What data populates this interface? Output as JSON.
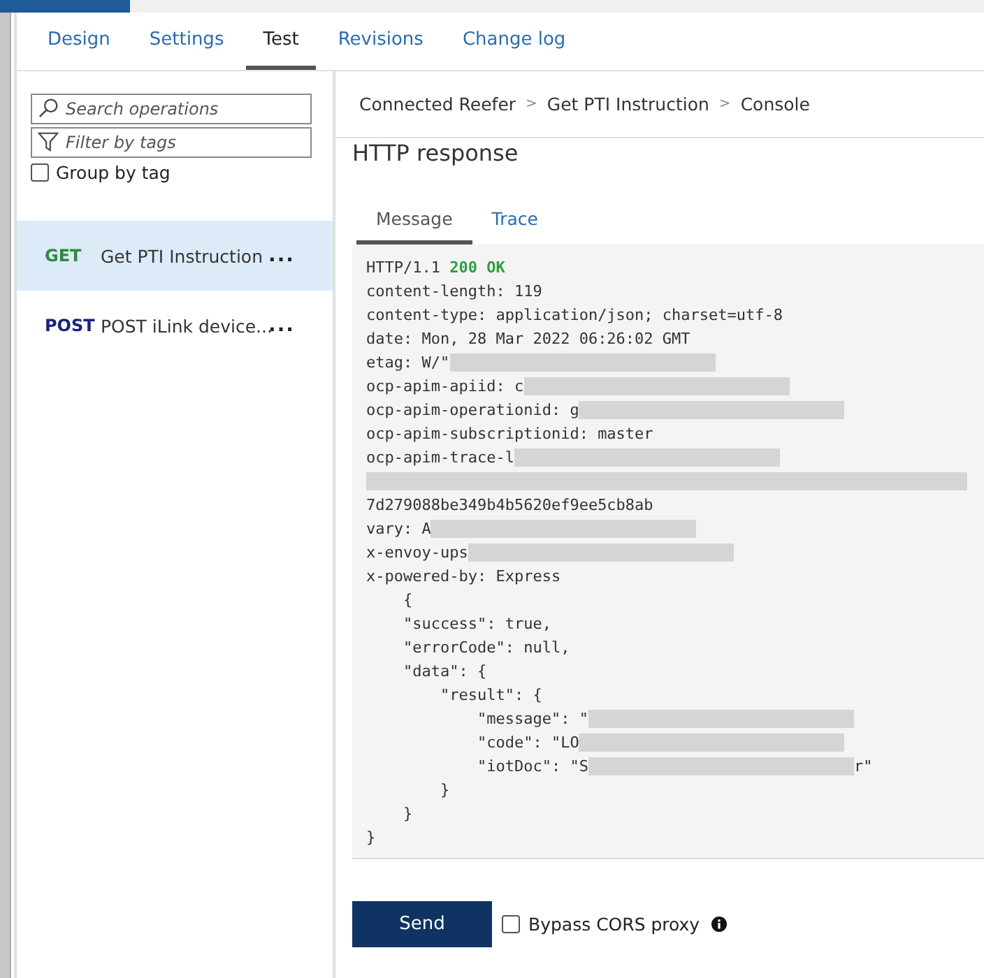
{
  "tabs": [
    {
      "label": "Design",
      "selected": false
    },
    {
      "label": "Settings",
      "selected": false
    },
    {
      "label": "Test",
      "selected": true
    },
    {
      "label": "Revisions",
      "selected": false
    },
    {
      "label": "Change log",
      "selected": false
    }
  ],
  "sidebar": {
    "search": {
      "placeholder": "Search operations"
    },
    "filter": {
      "placeholder": "Filter by tags"
    },
    "group_by_tag": {
      "label": "Group by tag",
      "checked": false
    },
    "operations": [
      {
        "method": "GET",
        "color": "#2e8b3e",
        "name": "Get PTI Instruction",
        "selected": true,
        "menu": "..."
      },
      {
        "method": "POST",
        "color": "#1a237e",
        "name": "POST iLink device...",
        "selected": false,
        "menu": "..."
      }
    ]
  },
  "breadcrumb": {
    "separator": ">",
    "items": [
      "Connected Reefer",
      "Get PTI Instruction",
      "Console"
    ]
  },
  "response": {
    "title": "HTTP response",
    "tabs": [
      {
        "label": "Message",
        "selected": true
      },
      {
        "label": "Trace",
        "selected": false
      }
    ],
    "lines": [
      {
        "text": "HTTP/1.1",
        "status": "200 OK"
      },
      {
        "text": "content-length: 119"
      },
      {
        "text": "content-type: application/json; charset=utf-8"
      },
      {
        "text": "date: Mon, 28 Mar 2022 06:26:02 GMT"
      },
      {
        "text": "etag: W/\"",
        "redacted": true
      },
      {
        "text": "ocp-apim-apiid: c",
        "redacted": true
      },
      {
        "text": "ocp-apim-operationid: g",
        "redacted": true
      },
      {
        "text": "ocp-apim-subscriptionid: master"
      },
      {
        "text": "ocp-apim-trace-l",
        "redacted": true
      },
      {
        "redacted": true
      },
      {
        "text": "7d279088be349b4b5620ef9ee5cb8ab"
      },
      {
        "text": "vary: A",
        "redacted": true
      },
      {
        "text": "x-envoy-ups",
        "redacted": true
      },
      {
        "text": "x-powered-by: Express"
      },
      {
        "text": "    {"
      },
      {
        "text": "    \"success\": true,"
      },
      {
        "text": "    \"errorCode\": null,"
      },
      {
        "text": "    \"data\": {"
      },
      {
        "text": "        \"result\": {"
      },
      {
        "text": "            \"message\": \"",
        "redacted": true
      },
      {
        "text": "            \"code\": \"LO",
        "redacted": true
      },
      {
        "text": "            \"iotDoc\": \"S",
        "redacted": true,
        "tail": "r\""
      },
      {
        "text": "        }"
      },
      {
        "text": "    }"
      },
      {
        "text": "}"
      }
    ]
  },
  "footer": {
    "send": "Send",
    "bypass": {
      "label": "Bypass CORS proxy",
      "checked": false
    }
  }
}
